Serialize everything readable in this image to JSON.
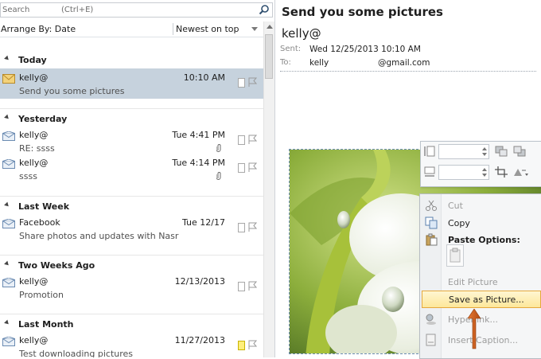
{
  "search": {
    "placeholder": "Search",
    "shortcut": "(Ctrl+E)"
  },
  "arrange": {
    "label": "Arrange By: Date",
    "order": "Newest on top"
  },
  "groups": [
    {
      "label": "Today"
    },
    {
      "label": "Yesterday"
    },
    {
      "label": "Last Week"
    },
    {
      "label": "Two Weeks Ago"
    },
    {
      "label": "Last Month"
    }
  ],
  "messages": [
    {
      "from": "kelly@",
      "subject": "Send you some pictures",
      "time": "10:10 AM",
      "selected": true,
      "attachment": false
    },
    {
      "from": "kelly@",
      "subject": "RE: ssss",
      "time": "Tue 4:41 PM",
      "attachment": true
    },
    {
      "from": "kelly@",
      "subject": "ssss",
      "time": "Tue 4:14 PM",
      "attachment": true
    },
    {
      "from": "Facebook",
      "subject": "Share photos and updates with Nasr",
      "time": "Tue 12/17",
      "attachment": false
    },
    {
      "from": "kelly@",
      "subject": "Promotion",
      "time": "12/13/2013",
      "attachment": false
    },
    {
      "from": "kelly@",
      "subject": "Test downloading pictures",
      "time": "11/27/2013",
      "attachment": false,
      "category": "yellow"
    }
  ],
  "reading": {
    "subject": "Send you some pictures",
    "sender": "kelly@",
    "sent_label": "Sent:",
    "sent_value": "Wed 12/25/2013 10:10 AM",
    "to_label": "To:",
    "to_value_1": "kelly",
    "to_value_2": "@gmail.com"
  },
  "context_menu": {
    "cut": "Cut",
    "copy": "Copy",
    "paste_options": "Paste Options:",
    "edit_picture": "Edit Picture",
    "save_as_picture": "Save as Picture...",
    "hyperlink": "Hyperlink...",
    "insert_caption": "Insert Caption..."
  },
  "colors": {
    "selection": "#c6d2dd",
    "menu_highlight": "#fde79a",
    "arrow": "#d2691e"
  }
}
